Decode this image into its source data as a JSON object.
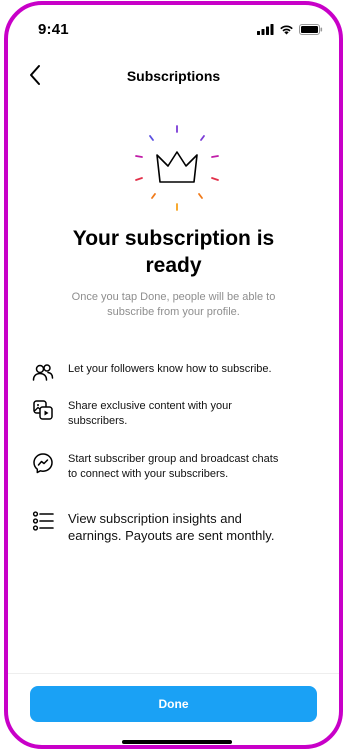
{
  "status_bar": {
    "time": "9:41",
    "icons": [
      "signal-icon",
      "wifi-icon",
      "battery-icon"
    ]
  },
  "header": {
    "back_icon": "chevron-left-icon",
    "title": "Subscriptions"
  },
  "hero": {
    "icon": "crown-icon",
    "heading_line1": "Your subscription is",
    "heading_line2": "ready",
    "subtext_line1": "Once you tap Done, people will be able to",
    "subtext_line2": "subscribe from your profile."
  },
  "features": [
    {
      "icon": "followers-icon",
      "lines": [
        "Let your followers know how to subscribe."
      ]
    },
    {
      "icon": "exclusive-content-icon",
      "lines": [
        "Share exclusive content with your",
        "subscribers."
      ]
    },
    {
      "icon": "messenger-icon",
      "lines": [
        "Start subscriber group and broadcast chats",
        "to connect with your subscribers."
      ]
    },
    {
      "icon": "insights-list-icon",
      "lines": [
        "View subscription insights and",
        "earnings. Payouts are sent monthly."
      ]
    }
  ],
  "footer": {
    "done_label": "Done"
  },
  "colors": {
    "frame": "#c800c8",
    "primary_button": "#1aa1f5",
    "subtext": "#8e8e8e"
  }
}
